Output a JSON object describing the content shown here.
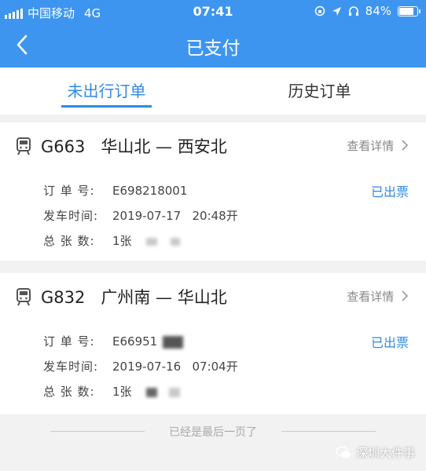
{
  "status_bar": {
    "carrier": "中国移动",
    "network": "4G",
    "time": "07:41",
    "battery": "84%",
    "battery_level": 0.84
  },
  "header": {
    "title": "已支付"
  },
  "tabs": [
    {
      "label": "未出行订单"
    },
    {
      "label": "历史订单"
    }
  ],
  "orders": [
    {
      "route": "G663   华山北 — 西安北",
      "detail_link": "查看详情 ",
      "order_label": "订 单 号:",
      "order_no": "E698218001",
      "depart_label": "发车时间:",
      "depart_time": "2019-07-17   20:48开",
      "count_label": "总 张 数:",
      "count": "1张",
      "status": "已出票"
    },
    {
      "route": "G832   广州南 — 华山北",
      "detail_link": "查看详情 ",
      "order_label": "订 单 号:",
      "order_no": "E66951",
      "depart_label": "发车时间:",
      "depart_time": "2019-07-16   07:04开",
      "count_label": "总 张 数:",
      "count": "1张",
      "status": "已出票"
    }
  ],
  "footer": {
    "end_text": "已经是最后一页了"
  },
  "watermark": {
    "text": "深圳大件事"
  },
  "colors": {
    "primary": "#3d95f0",
    "accent": "#2e8ae6"
  }
}
